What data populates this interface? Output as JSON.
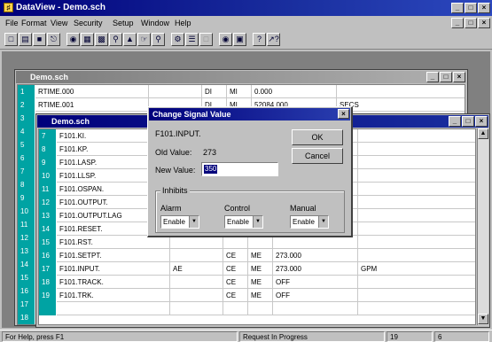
{
  "app": {
    "title": "DataView - Demo.sch",
    "icon": "app-icon"
  },
  "menu": [
    "File",
    "Format",
    "View",
    "Security",
    "Setup",
    "Window",
    "Help"
  ],
  "toolbar": {
    "icons": [
      "new-icon",
      "open-icon",
      "save-icon",
      "print-icon",
      "tag-icon",
      "chart-icon",
      "table-icon",
      "find-icon",
      "trend-icon",
      "select-icon",
      "zoom-icon",
      "config-icon",
      "tree-icon",
      "disabled-icon",
      "connect-icon",
      "display-icon",
      "help-icon",
      "context-help-icon"
    ]
  },
  "window1": {
    "title": "Demo.sch",
    "rows": [
      {
        "n": "1",
        "tag": "RTIME.000",
        "c1": "",
        "c2": "DI",
        "c3": "MI",
        "c4": "0.000",
        "c5": ""
      },
      {
        "n": "2",
        "tag": "RTIME.001",
        "c1": "",
        "c2": "DI",
        "c3": "MI",
        "c4": "52084.000",
        "c5": "SECS"
      },
      {
        "n": "3",
        "tag": "",
        "c1": "",
        "c2": "",
        "c3": "",
        "c4": "",
        "c5": ""
      },
      {
        "n": "4",
        "tag": "",
        "c1": "",
        "c2": "",
        "c3": "",
        "c4": "",
        "c5": ""
      },
      {
        "n": "5",
        "tag": "",
        "c1": "",
        "c2": "",
        "c3": "",
        "c4": "",
        "c5": ""
      },
      {
        "n": "6",
        "tag": "",
        "c1": "",
        "c2": "",
        "c3": "",
        "c4": "",
        "c5": ""
      },
      {
        "n": "7",
        "tag": "",
        "c1": "",
        "c2": "",
        "c3": "",
        "c4": "",
        "c5": ""
      },
      {
        "n": "8",
        "tag": "",
        "c1": "",
        "c2": "",
        "c3": "",
        "c4": "",
        "c5": ""
      },
      {
        "n": "9",
        "tag": "",
        "c1": "",
        "c2": "",
        "c3": "",
        "c4": "",
        "c5": ""
      },
      {
        "n": "10",
        "tag": "",
        "c1": "",
        "c2": "",
        "c3": "",
        "c4": "",
        "c5": ""
      },
      {
        "n": "11",
        "tag": "",
        "c1": "",
        "c2": "",
        "c3": "",
        "c4": "",
        "c5": ""
      },
      {
        "n": "12",
        "tag": "",
        "c1": "",
        "c2": "",
        "c3": "",
        "c4": "",
        "c5": ""
      },
      {
        "n": "13",
        "tag": "",
        "c1": "",
        "c2": "",
        "c3": "",
        "c4": "",
        "c5": ""
      },
      {
        "n": "14",
        "tag": "",
        "c1": "",
        "c2": "",
        "c3": "",
        "c4": "",
        "c5": ""
      },
      {
        "n": "15",
        "tag": "",
        "c1": "",
        "c2": "",
        "c3": "",
        "c4": "",
        "c5": ""
      },
      {
        "n": "16",
        "tag": "",
        "c1": "",
        "c2": "",
        "c3": "",
        "c4": "",
        "c5": ""
      },
      {
        "n": "17",
        "tag": "",
        "c1": "",
        "c2": "",
        "c3": "",
        "c4": "",
        "c5": ""
      },
      {
        "n": "18",
        "tag": "",
        "c1": "",
        "c2": "",
        "c3": "",
        "c4": "",
        "c5": ""
      },
      {
        "n": "19",
        "tag": "",
        "c1": "",
        "c2": "",
        "c3": "",
        "c4": "",
        "c5": ""
      }
    ]
  },
  "window2": {
    "title": "Demo.sch",
    "rows": [
      {
        "n": "7",
        "tag": "F101.KI.",
        "c1": "",
        "c2": "",
        "c3": "",
        "c4": "",
        "c5": ""
      },
      {
        "n": "8",
        "tag": "F101.KP.",
        "c1": "",
        "c2": "",
        "c3": "",
        "c4": "",
        "c5": ""
      },
      {
        "n": "9",
        "tag": "F101.LASP.",
        "c1": "",
        "c2": "",
        "c3": "",
        "c4": "",
        "c5": ""
      },
      {
        "n": "10",
        "tag": "F101.LLSP.",
        "c1": "",
        "c2": "",
        "c3": "",
        "c4": "",
        "c5": ""
      },
      {
        "n": "11",
        "tag": "F101.OSPAN.",
        "c1": "",
        "c2": "",
        "c3": "",
        "c4": "",
        "c5": ""
      },
      {
        "n": "12",
        "tag": "F101.OUTPUT.",
        "c1": "",
        "c2": "",
        "c3": "",
        "c4": "",
        "c5": ""
      },
      {
        "n": "13",
        "tag": "F101.OUTPUT.LAG",
        "c1": "",
        "c2": "",
        "c3": "",
        "c4": "",
        "c5": ""
      },
      {
        "n": "14",
        "tag": "F101.RESET.",
        "c1": "",
        "c2": "",
        "c3": "",
        "c4": "",
        "c5": ""
      },
      {
        "n": "15",
        "tag": "F101.RST.",
        "c1": "",
        "c2": "",
        "c3": "",
        "c4": "",
        "c5": ""
      },
      {
        "n": "16",
        "tag": "F101.SETPT.",
        "c1": "",
        "c2": "CE",
        "c3": "ME",
        "c4": "273.000",
        "c5": ""
      },
      {
        "n": "17",
        "tag": "F101.INPUT.",
        "c1": "AE",
        "c2": "CE",
        "c3": "ME",
        "c4": "273.000",
        "c5": "GPM"
      },
      {
        "n": "18",
        "tag": "F101.TRACK.",
        "c1": "",
        "c2": "CE",
        "c3": "ME",
        "c4": "OFF",
        "c5": ""
      },
      {
        "n": "19",
        "tag": "F101.TRK.",
        "c1": "",
        "c2": "CE",
        "c3": "ME",
        "c4": "OFF",
        "c5": ""
      },
      {
        "n": "",
        "tag": "",
        "c1": "",
        "c2": "",
        "c3": "",
        "c4": "",
        "c5": ""
      }
    ]
  },
  "dialog": {
    "title": "Change Signal Value",
    "signal": "F101.INPUT.",
    "old_label": "Old Value:",
    "old_value": "273",
    "new_label": "New Value:",
    "new_value": "350",
    "ok": "OK",
    "cancel": "Cancel",
    "inhibits_label": "Inhibits",
    "alarm_label": "Alarm",
    "alarm_value": "Enable",
    "control_label": "Control",
    "control_value": "Enable",
    "manual_label": "Manual",
    "manual_value": "Enable"
  },
  "status": {
    "help": "For Help, press F1",
    "progress": "Request In Progress",
    "p1": "19",
    "p2": "6"
  }
}
